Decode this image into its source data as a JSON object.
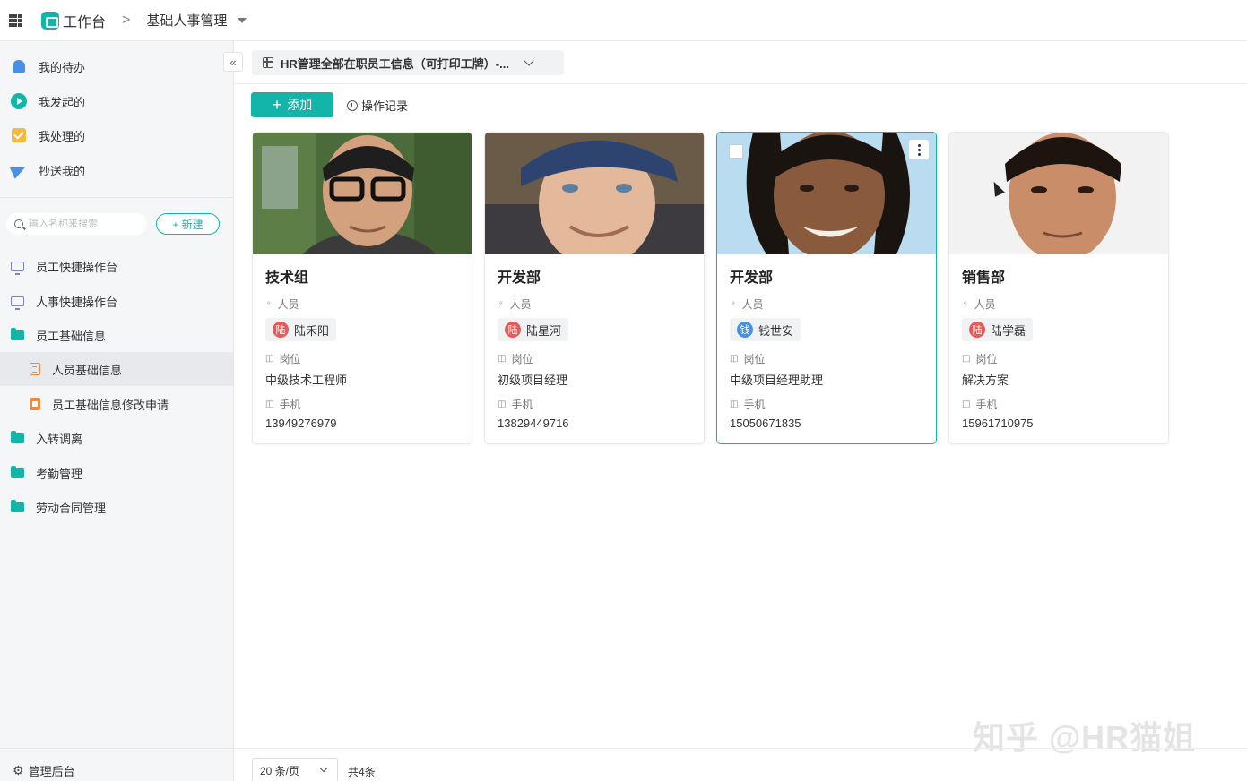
{
  "topbar": {
    "brand": "工作台",
    "separator": ">",
    "breadcrumb": "基础人事管理"
  },
  "sidebar": {
    "quick": [
      {
        "label": "我的待办",
        "icon": "bell-icon"
      },
      {
        "label": "我发起的",
        "icon": "play-icon"
      },
      {
        "label": "我处理的",
        "icon": "check-icon"
      },
      {
        "label": "抄送我的",
        "icon": "send-icon"
      }
    ],
    "search_placeholder": "输入名称来搜索",
    "new_label": "+ 新建",
    "nav": [
      {
        "label": "员工快捷操作台",
        "icon": "monitor-icon"
      },
      {
        "label": "人事快捷操作台",
        "icon": "monitor-icon"
      },
      {
        "label": "员工基础信息",
        "icon": "folder-icon"
      },
      {
        "label": "人员基础信息",
        "icon": "document-icon"
      },
      {
        "label": "员工基础信息修改申请",
        "icon": "form-icon"
      },
      {
        "label": "入转调离",
        "icon": "folder-icon"
      },
      {
        "label": "考勤管理",
        "icon": "folder-icon"
      },
      {
        "label": "劳动合同管理",
        "icon": "folder-icon"
      }
    ],
    "admin_label": "管理后台",
    "collapse_glyph": "«"
  },
  "view": {
    "tab_label": "HR管理全部在职员工信息（可打印工牌）-..."
  },
  "toolbar": {
    "add_label": "添加",
    "log_label": "操作记录"
  },
  "field_labels": {
    "person": "人员",
    "position": "岗位",
    "phone": "手机"
  },
  "cards": [
    {
      "department": "技术组",
      "person": "陆禾阳",
      "avatar_char": "陆",
      "avatar_color": "#e35b5b",
      "position": "中级技术工程师",
      "phone": "13949276979",
      "selected": false
    },
    {
      "department": "开发部",
      "person": "陆星河",
      "avatar_char": "陆",
      "avatar_color": "#e35b5b",
      "position": "初级项目经理",
      "phone": "13829449716",
      "selected": false
    },
    {
      "department": "开发部",
      "person": "钱世安",
      "avatar_char": "钱",
      "avatar_color": "#4a90e2",
      "position": "中级项目经理助理",
      "phone": "15050671835",
      "selected": true
    },
    {
      "department": "销售部",
      "person": "陆学磊",
      "avatar_char": "陆",
      "avatar_color": "#e35b5b",
      "position": "解决方案",
      "phone": "15961710975",
      "selected": false
    }
  ],
  "pagination": {
    "page_size": "20 条/页",
    "total": "共4条"
  },
  "watermark": "知乎 @HR猫姐",
  "colors": {
    "accent": "#13b5a9",
    "sidebar_bg": "#f5f6f8"
  }
}
